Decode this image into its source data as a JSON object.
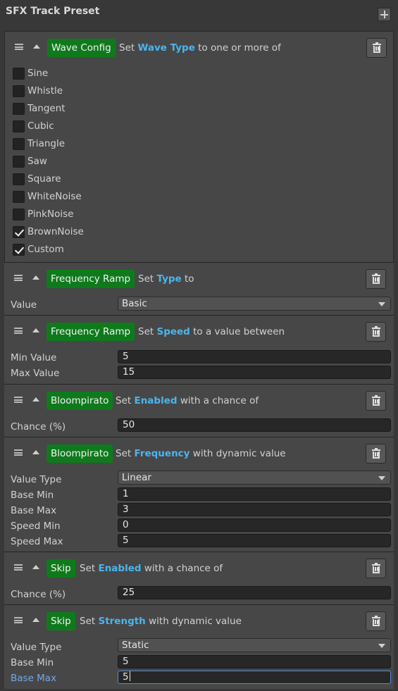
{
  "header": {
    "title": "SFX Track Preset"
  },
  "panels": {
    "p0": {
      "tag": "Wave Config",
      "desc_pre": "Set",
      "keyword": "Wave Type",
      "desc_post": "to one or more of",
      "options": [
        {
          "label": "Sine",
          "checked": false
        },
        {
          "label": "Whistle",
          "checked": false
        },
        {
          "label": "Tangent",
          "checked": false
        },
        {
          "label": "Cubic",
          "checked": false
        },
        {
          "label": "Triangle",
          "checked": false
        },
        {
          "label": "Saw",
          "checked": false
        },
        {
          "label": "Square",
          "checked": false
        },
        {
          "label": "WhiteNoise",
          "checked": false
        },
        {
          "label": "PinkNoise",
          "checked": false
        },
        {
          "label": "BrownNoise",
          "checked": true
        },
        {
          "label": "Custom",
          "checked": true
        }
      ]
    },
    "p1": {
      "tag": "Frequency Ramp",
      "desc_pre": "Set",
      "keyword": "Type",
      "desc_post": "to",
      "fields": [
        {
          "label": "Value",
          "value": "Basic"
        }
      ]
    },
    "p2": {
      "tag": "Frequency Ramp",
      "desc_pre": "Set",
      "keyword": "Speed",
      "desc_post": "to a value between",
      "fields": [
        {
          "label": "Min Value",
          "value": "5"
        },
        {
          "label": "Max Value",
          "value": "15"
        }
      ]
    },
    "p3": {
      "tag": "Bloompirato",
      "desc_pre": "Set",
      "keyword": "Enabled",
      "desc_post": "with a chance of",
      "fields": [
        {
          "label": "Chance (%)",
          "value": "50"
        }
      ]
    },
    "p4": {
      "tag": "Bloompirato",
      "desc_pre": "Set",
      "keyword": "Frequency",
      "desc_post": "with dynamic value",
      "fields": [
        {
          "label": "Value Type",
          "value": "Linear"
        },
        {
          "label": "Base Min",
          "value": "1"
        },
        {
          "label": "Base Max",
          "value": "3"
        },
        {
          "label": "Speed Min",
          "value": "0"
        },
        {
          "label": "Speed Max",
          "value": "5"
        }
      ]
    },
    "p5": {
      "tag": "Skip",
      "desc_pre": "Set",
      "keyword": "Enabled",
      "desc_post": "with a chance of",
      "fields": [
        {
          "label": "Chance (%)",
          "value": "25"
        }
      ]
    },
    "p6": {
      "tag": "Skip",
      "desc_pre": "Set",
      "keyword": "Strength",
      "desc_post": "with dynamic value",
      "fields": [
        {
          "label": "Value Type",
          "value": "Static"
        },
        {
          "label": "Base Min",
          "value": "5"
        },
        {
          "label": "Base Max",
          "value": "5"
        }
      ]
    }
  }
}
